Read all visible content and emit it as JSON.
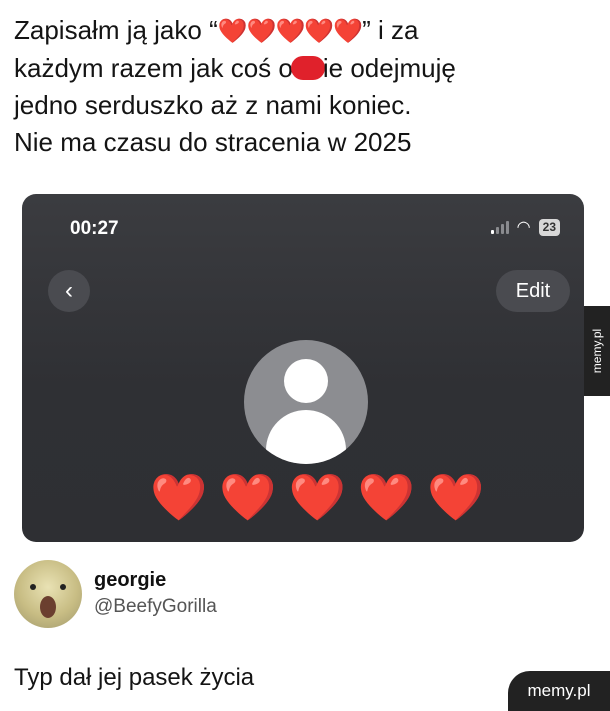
{
  "post": {
    "line1_before": "Zapisałm ją jako “",
    "line1_hearts": "❤️❤️❤️❤️❤️",
    "line1_after": "” i za",
    "line2_before": "każdym razem jak coś o",
    "line2_after": "ie odejmuję",
    "line3": "jedno serduszko aż z nami koniec.",
    "line4": "Nie ma czasu do stracenia w 2025"
  },
  "phone": {
    "time": "00:27",
    "battery": "23",
    "back_icon": "chevron-left-icon",
    "edit_label": "Edit",
    "contact_name_hearts": [
      "❤️",
      "❤️",
      "❤️",
      "❤️",
      "❤️"
    ]
  },
  "author": {
    "name": "georgie",
    "handle": "@BeefyGorilla"
  },
  "tweet": {
    "text": "Typ dał jej pasek życia"
  },
  "watermarks": {
    "side": "memy.pl",
    "bottom": "memy.pl"
  },
  "colors": {
    "heart": "#e53238",
    "phone_bg": "#2f3034",
    "censor": "#e0212b"
  }
}
